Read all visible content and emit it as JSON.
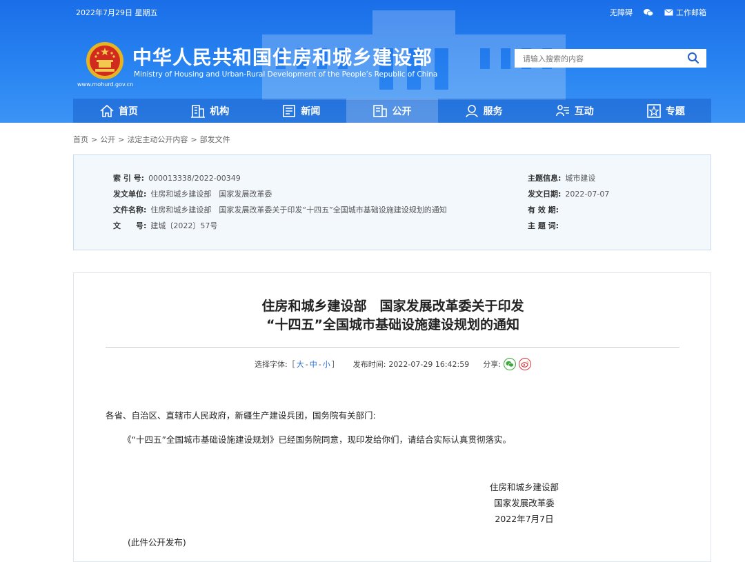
{
  "header": {
    "date": "2022年7月29日 星期五",
    "links": [
      "无障碍",
      "工作邮箱"
    ],
    "site_url": "www.mohurd.gov.cn",
    "title_cn": "中华人民共和国住房和城乡建设部",
    "title_en": "Ministry of Housing and Urban-Rural Development of the People’s Republic of China",
    "search_placeholder": "请输入搜索的内容"
  },
  "nav": [
    "首页",
    "机构",
    "新闻",
    "公开",
    "服务",
    "互动",
    "专题"
  ],
  "breadcrumb": [
    "首页",
    "公开",
    "法定主动公开内容",
    "部发文件"
  ],
  "info": {
    "index_label": "索 引 号:",
    "index_value": "000013338/2022-00349",
    "issuer_label": "发文单位:",
    "issuer_value": "住房和城乡建设部　国家发展改革委",
    "filename_label": "文件名称:",
    "filename_value": "住房和城乡建设部　国家发展改革委关于印发“十四五”全国城市基础设施建设规划的通知",
    "docno_label": "文　　号:",
    "docno_value": "建城〔2022〕57号",
    "topic_label": "主题信息:",
    "topic_value": "城市建设",
    "date_label": "发文日期:",
    "date_value": "2022-07-07",
    "valid_label": "有 效 期:",
    "keywords_label": "主 题 词:"
  },
  "article": {
    "title_line1": "住房和城乡建设部　国家发展改革委关于印发",
    "title_line2": "“十四五”全国城市基础设施建设规划的通知",
    "font_label": "选择字体:［",
    "font_big": "大",
    "font_mid": "中",
    "font_small": "小",
    "font_end": "］",
    "publish_label": "发布时间:",
    "publish_time": "2022-07-29 16:42:59",
    "share_label": "分享:",
    "salutation": "各省、自治区、直辖市人民政府，新疆生产建设兵团，国务院有关部门:",
    "paragraph": "《“十四五”全国城市基础设施建设规划》已经国务院同意，现印发给你们，请结合实际认真贯彻落实。",
    "signer1": "住房和城乡建设部",
    "signer2": "国家发展改革委",
    "sign_date": "2022年7月7日",
    "note": "(此件公开发布)"
  },
  "colors": {
    "header_blue": "#1a6ee8",
    "link_blue": "#2a6fd8",
    "wechat_green": "#3aa83a",
    "weibo_red": "#d9363e"
  }
}
